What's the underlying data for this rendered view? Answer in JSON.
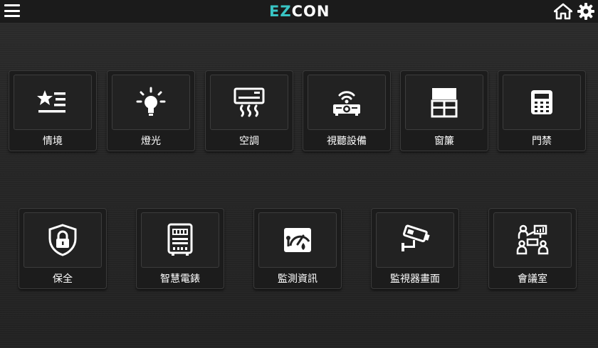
{
  "header": {
    "logo_part1": "EZ",
    "logo_part2": "CON",
    "menu_icon": "hamburger-icon",
    "home_icon": "home-icon",
    "settings_icon": "gear-icon"
  },
  "tiles": [
    {
      "label": "情境",
      "icon": "scene-icon"
    },
    {
      "label": "燈光",
      "icon": "light-bulb-icon"
    },
    {
      "label": "空調",
      "icon": "air-conditioner-icon"
    },
    {
      "label": "視聽設備",
      "icon": "projector-icon"
    },
    {
      "label": "窗簾",
      "icon": "curtain-icon"
    },
    {
      "label": "門禁",
      "icon": "keypad-icon"
    },
    {
      "label": "保全",
      "icon": "shield-lock-icon"
    },
    {
      "label": "智慧電錶",
      "icon": "electric-meter-icon"
    },
    {
      "label": "監測資訊",
      "icon": "gauge-icon"
    },
    {
      "label": "監視器畫面",
      "icon": "cctv-camera-icon"
    },
    {
      "label": "會議室",
      "icon": "meeting-room-icon"
    }
  ],
  "colors": {
    "accent": "#39c5c5",
    "tile_bg": "#1c1c1c",
    "topbar_bg": "#1b1b1b"
  }
}
